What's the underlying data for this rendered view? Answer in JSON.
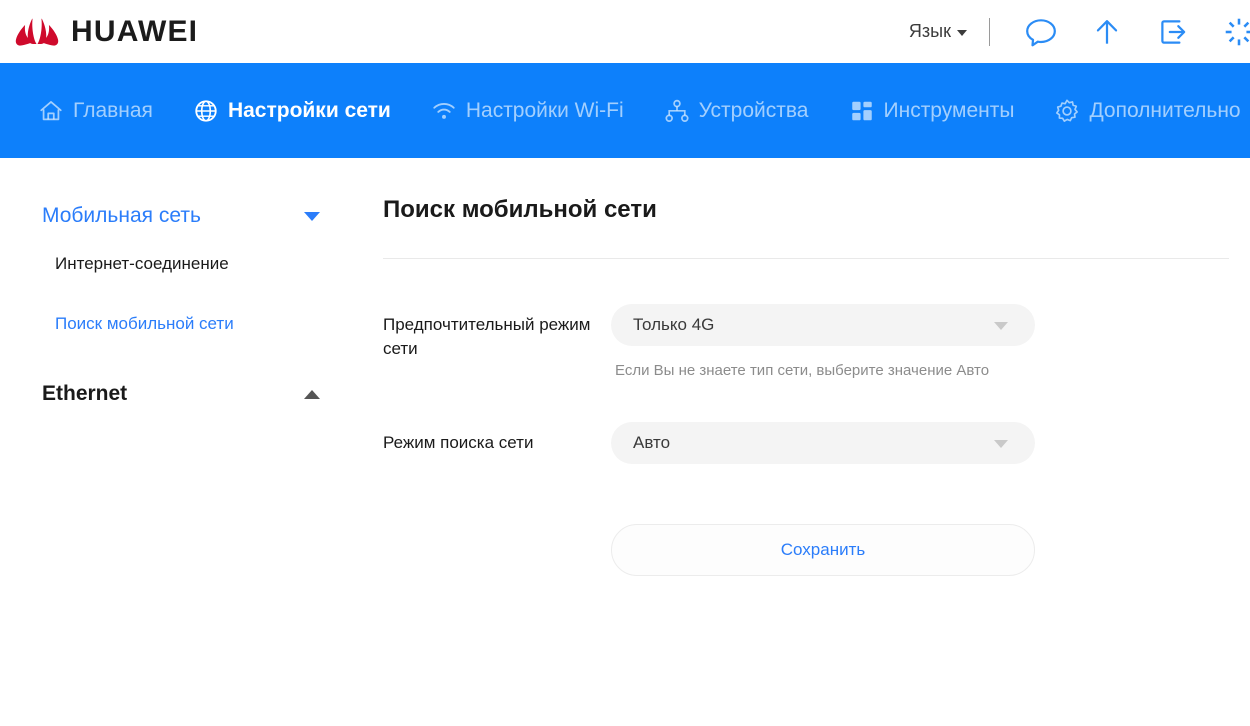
{
  "header": {
    "brand": "HUAWEI",
    "language_label": "Язык",
    "icons": [
      {
        "name": "sms-icon",
        "title": "SMS"
      },
      {
        "name": "update-icon",
        "title": "Update"
      },
      {
        "name": "logout-icon",
        "title": "Logout"
      },
      {
        "name": "loading-spinner-icon",
        "title": "Loading"
      }
    ]
  },
  "nav": {
    "items": [
      {
        "label": "Главная",
        "icon": "home-icon",
        "active": false
      },
      {
        "label": "Настройки сети",
        "icon": "globe-icon",
        "active": true
      },
      {
        "label": "Настройки Wi-Fi",
        "icon": "wifi-icon",
        "active": false
      },
      {
        "label": "Устройства",
        "icon": "devices-tree-icon",
        "active": false
      },
      {
        "label": "Инструменты",
        "icon": "grid-tools-icon",
        "active": false
      },
      {
        "label": "Дополнительно",
        "icon": "gear-icon",
        "active": false
      }
    ]
  },
  "sidebar": {
    "groups": [
      {
        "label": "Мобильная сеть",
        "expanded": true,
        "items": [
          {
            "label": "Интернет-соединение",
            "active": false
          },
          {
            "label": "Поиск мобильной сети",
            "active": true
          }
        ]
      },
      {
        "label": "Ethernet",
        "expanded": false,
        "items": []
      }
    ]
  },
  "main": {
    "title": "Поиск мобильной сети",
    "fields": [
      {
        "label": "Предпочтительный режим сети",
        "value": "Только 4G",
        "hint": "Если Вы не знаете тип сети, выберите значение Авто"
      },
      {
        "label": "Режим поиска сети",
        "value": "Авто",
        "hint": ""
      }
    ],
    "save_label": "Сохранить"
  },
  "colors": {
    "nav_blue": "#0d80fb",
    "accent_blue": "#2b7dfa",
    "brand_red": "#cf0a2c"
  }
}
